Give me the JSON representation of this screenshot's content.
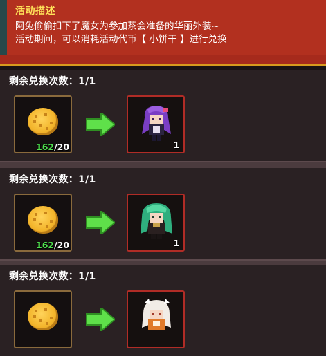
{
  "event": {
    "title": "活动描述",
    "line1": "阿兔偷偷扣下了魔女为参加茶会准备的华丽外装~",
    "line2": "活动期间，可以消耗活动代币【 小饼干 】进行兑换"
  },
  "colors": {
    "header_bg": "#b2301f",
    "title": "#ffe25a",
    "have_count": "#4fe24e",
    "arrow": "#5fe04a",
    "reward_border": "#b02c26",
    "cost_border": "#8a6a3c"
  },
  "rows": [
    {
      "remaining_label": "剩余兑换次数：1/1",
      "cost_icon": "cookie-icon",
      "cost_have": "162",
      "cost_need": "/20",
      "reward_icon": "purple-hair-outfit-icon",
      "reward_qty": "1"
    },
    {
      "remaining_label": "剩余兑换次数：1/1",
      "cost_icon": "cookie-icon",
      "cost_have": "162",
      "cost_need": "/20",
      "reward_icon": "green-hair-outfit-icon",
      "reward_qty": "1"
    },
    {
      "remaining_label": "剩余兑换次数：1/1",
      "cost_icon": "cookie-icon",
      "cost_have": "",
      "cost_need": "",
      "reward_icon": "white-hair-outfit-icon",
      "reward_qty": ""
    }
  ]
}
